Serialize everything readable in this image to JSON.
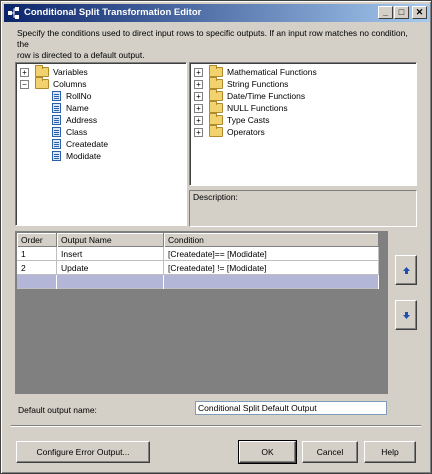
{
  "window": {
    "title": "Conditional Split Transformation Editor",
    "minimize": "_",
    "maximize": "□",
    "close": "✕"
  },
  "instructions": "Specify the conditions used to direct input rows to specific outputs. If an input row matches no condition, the\nrow is directed to a default output.",
  "columns_tree": {
    "variables_label": "Variables",
    "columns_label": "Columns",
    "columns": [
      "RollNo",
      "Name",
      "Address",
      "Class",
      "Createdate",
      "Modidate"
    ]
  },
  "functions_tree": {
    "items": [
      "Mathematical Functions",
      "String Functions",
      "Date/Time Functions",
      "NULL Functions",
      "Type Casts",
      "Operators"
    ]
  },
  "description": {
    "label": "Description:"
  },
  "grid": {
    "headers": {
      "order": "Order",
      "name": "Output Name",
      "condition": "Condition"
    },
    "rows": [
      {
        "order": "1",
        "name": "Insert",
        "condition": "[Createdate]== [Modidate]"
      },
      {
        "order": "2",
        "name": "Update",
        "condition": "[Createdate] != [Modidate]"
      }
    ]
  },
  "default_output": {
    "label": "Default output name:",
    "value": "Conditional Split Default Output"
  },
  "buttons": {
    "configure_error": "Configure Error Output...",
    "ok": "OK",
    "cancel": "Cancel",
    "help": "Help"
  },
  "colors": {
    "selected_row": "#b3b6d7",
    "titlebar_start": "#0a246a",
    "titlebar_end": "#a6caf0"
  }
}
